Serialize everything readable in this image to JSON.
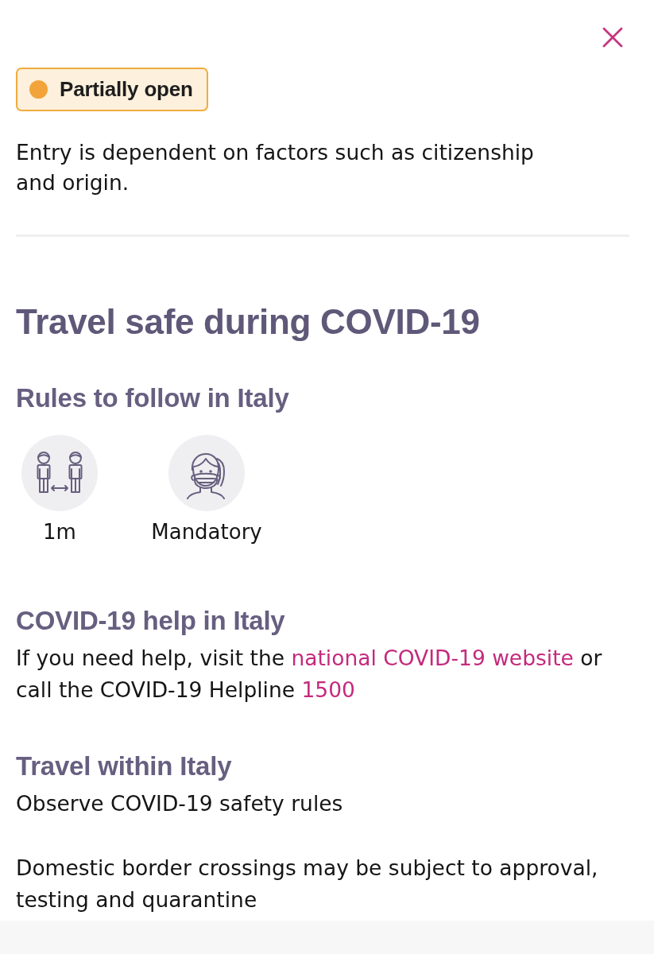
{
  "status": {
    "label": "Partially open",
    "color": "#f2a33a"
  },
  "description": "Entry is dependent on factors such as citizenship and origin.",
  "covid_section": {
    "title": "Travel safe during COVID-19",
    "rules": {
      "heading": "Rules to follow in Italy",
      "items": [
        {
          "kind": "distance",
          "label": "1m"
        },
        {
          "kind": "mask",
          "label": "Mandatory"
        }
      ]
    },
    "help": {
      "heading": "COVID-19 help in Italy",
      "text": [
        {
          "kind": "text",
          "text": "If you need help, visit the "
        },
        {
          "kind": "link",
          "text": "national COVID-19 website"
        },
        {
          "kind": "text",
          "text": " or call the COVID-19 Helpline "
        },
        {
          "kind": "link",
          "text": "1500"
        }
      ]
    },
    "travel_within": {
      "heading": "Travel within Italy",
      "paragraphs": [
        "Observe COVID-19 safety rules",
        "Domestic border crossings may be subject to approval, testing and quarantine"
      ]
    }
  }
}
